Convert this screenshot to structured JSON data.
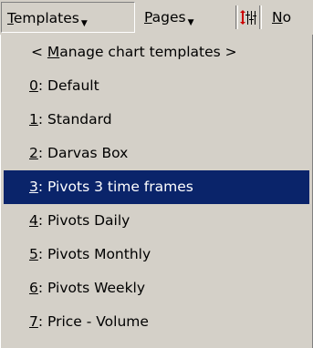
{
  "menubar": {
    "templates": {
      "accel": "T",
      "rest": "emplates"
    },
    "pages": {
      "accel": "P",
      "rest": "ages"
    },
    "toolbar_icon": "chart-settings-icon",
    "cut_item": {
      "accel": "N",
      "rest": "o"
    }
  },
  "menu": {
    "manage": {
      "pre": "< ",
      "accel": "M",
      "rest": "anage chart templates >"
    },
    "items": [
      {
        "accel": "0",
        "rest": ": Default"
      },
      {
        "accel": "1",
        "rest": ": Standard"
      },
      {
        "accel": "2",
        "rest": ": Darvas Box"
      },
      {
        "accel": "3",
        "rest": ": Pivots 3 time frames",
        "selected": true
      },
      {
        "accel": "4",
        "rest": ": Pivots Daily"
      },
      {
        "accel": "5",
        "rest": ": Pivots Monthly"
      },
      {
        "accel": "6",
        "rest": ": Pivots Weekly"
      },
      {
        "accel": "7",
        "rest": ": Price - Volume"
      }
    ]
  },
  "colors": {
    "face": "#d4d0c8",
    "highlight": "#0a246a",
    "icon_red": "#cc0000"
  }
}
